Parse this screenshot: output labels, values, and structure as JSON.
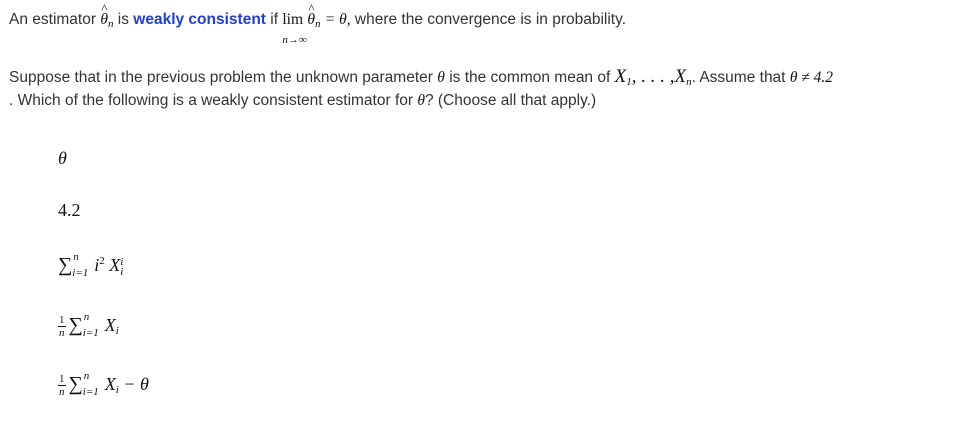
{
  "definition": {
    "prefix": "An estimator",
    "theta_hat": "θ",
    "n_sub": "n",
    "is_text": "is",
    "term": "weakly consistent",
    "if_text": "if",
    "lim": "lim",
    "lim_sub": "n→∞",
    "equals_theta": "= θ,",
    "suffix": "where the convergence is in probability."
  },
  "question": {
    "line1_prefix": "Suppose that in the previous problem the unknown parameter",
    "theta": "θ",
    "line1_mid": "is the common mean of",
    "x_seq": "X",
    "x_sub1": "1",
    "dots": ", . . . ,",
    "x_subn": "n",
    "line1_assume": ". Assume that",
    "neq": "θ ≠ 4.2",
    "line2_prefix": ". Which of the following is a weakly consistent estimator for",
    "line2_suffix": "? (Choose all that apply.)"
  },
  "options": [
    {
      "text": "θ"
    },
    {
      "text": "4.2"
    },
    {
      "sigma": "∑",
      "upper": "n",
      "lower": "i=1",
      "body": "i",
      "sup": "2",
      "x": "X",
      "xsup": "i",
      "xsub": "i"
    },
    {
      "frac_num": "1",
      "frac_den": "n",
      "sigma": "∑",
      "upper": "n",
      "lower": "i=1",
      "x": "X",
      "xsub": "i"
    },
    {
      "frac_num": "1",
      "frac_den": "n",
      "sigma": "∑",
      "upper": "n",
      "lower": "i=1",
      "x": "X",
      "xsub": "i",
      "tail": "− θ"
    }
  ]
}
